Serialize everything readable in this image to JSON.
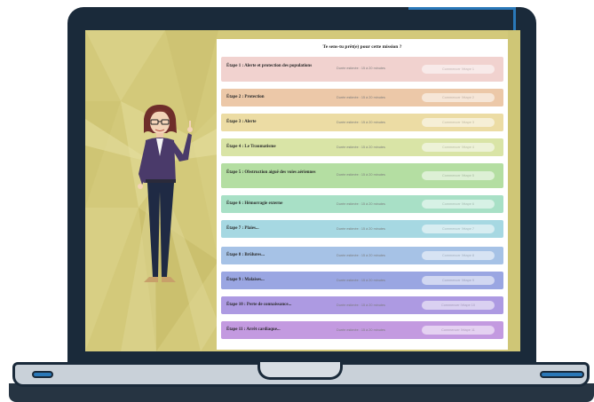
{
  "course": {
    "question": "Te sens-tu prêt(e) pour cette mission ?",
    "steps": [
      {
        "title": "Étape 1 : Alerte et protection des populations",
        "duration": "Durée estimée : 15 à 20 minutes",
        "button": "Commencer l'étape 1",
        "color": "#f1d2cf"
      },
      {
        "title": "Étape 2 : Protection",
        "duration": "Durée estimée : 15 à 20 minutes",
        "button": "Commencer l'étape 2",
        "color": "#ecc8a8"
      },
      {
        "title": "Étape 3 : Alerte",
        "duration": "Durée estimée : 15 à 20 minutes",
        "button": "Commencer l'étape 3",
        "color": "#ecdca4"
      },
      {
        "title": "Étape 4 : Le Traumatisme",
        "duration": "Durée estimée : 15 à 20 minutes",
        "button": "Commencer l'étape 4",
        "color": "#d9e4a6"
      },
      {
        "title": "Étape 5 : Obstruction aiguë des voies aériennes",
        "duration": "Durée estimée : 15 à 20 minutes",
        "button": "Commencer l'étape 5",
        "color": "#b4dea2"
      },
      {
        "title": "Étape 6 : Hémorragie externe",
        "duration": "Durée estimée : 15 à 20 minutes",
        "button": "Commencer l'étape 6",
        "color": "#a8e0c6"
      },
      {
        "title": "Étape 7 : Plaies...",
        "duration": "Durée estimée : 15 à 20 minutes",
        "button": "Commencer l'étape 7",
        "color": "#a6d8e2"
      },
      {
        "title": "Étape 8 : Brûlures...",
        "duration": "Durée estimée : 15 à 20 minutes",
        "button": "Commencer l'étape 8",
        "color": "#a6c2e6"
      },
      {
        "title": "Étape 9 : Malaises...",
        "duration": "Durée estimée : 15 à 20 minutes",
        "button": "Commencer l'étape 9",
        "color": "#9aa6e2"
      },
      {
        "title": "Étape 10 : Perte de connaissance...",
        "duration": "Durée estimée : 15 à 20 minutes",
        "button": "Commencer l'étape 10",
        "color": "#ad9ae2"
      },
      {
        "title": "Étape 11 : Arrêt cardiaque...",
        "duration": "Durée estimée : 15 à 20 minutes",
        "button": "Commencer l'étape 11",
        "color": "#c39ae0"
      }
    ]
  },
  "colors": {
    "frame": "#1a2a3a",
    "accent": "#2a78b8",
    "screen_bg": "#d6cc78"
  }
}
